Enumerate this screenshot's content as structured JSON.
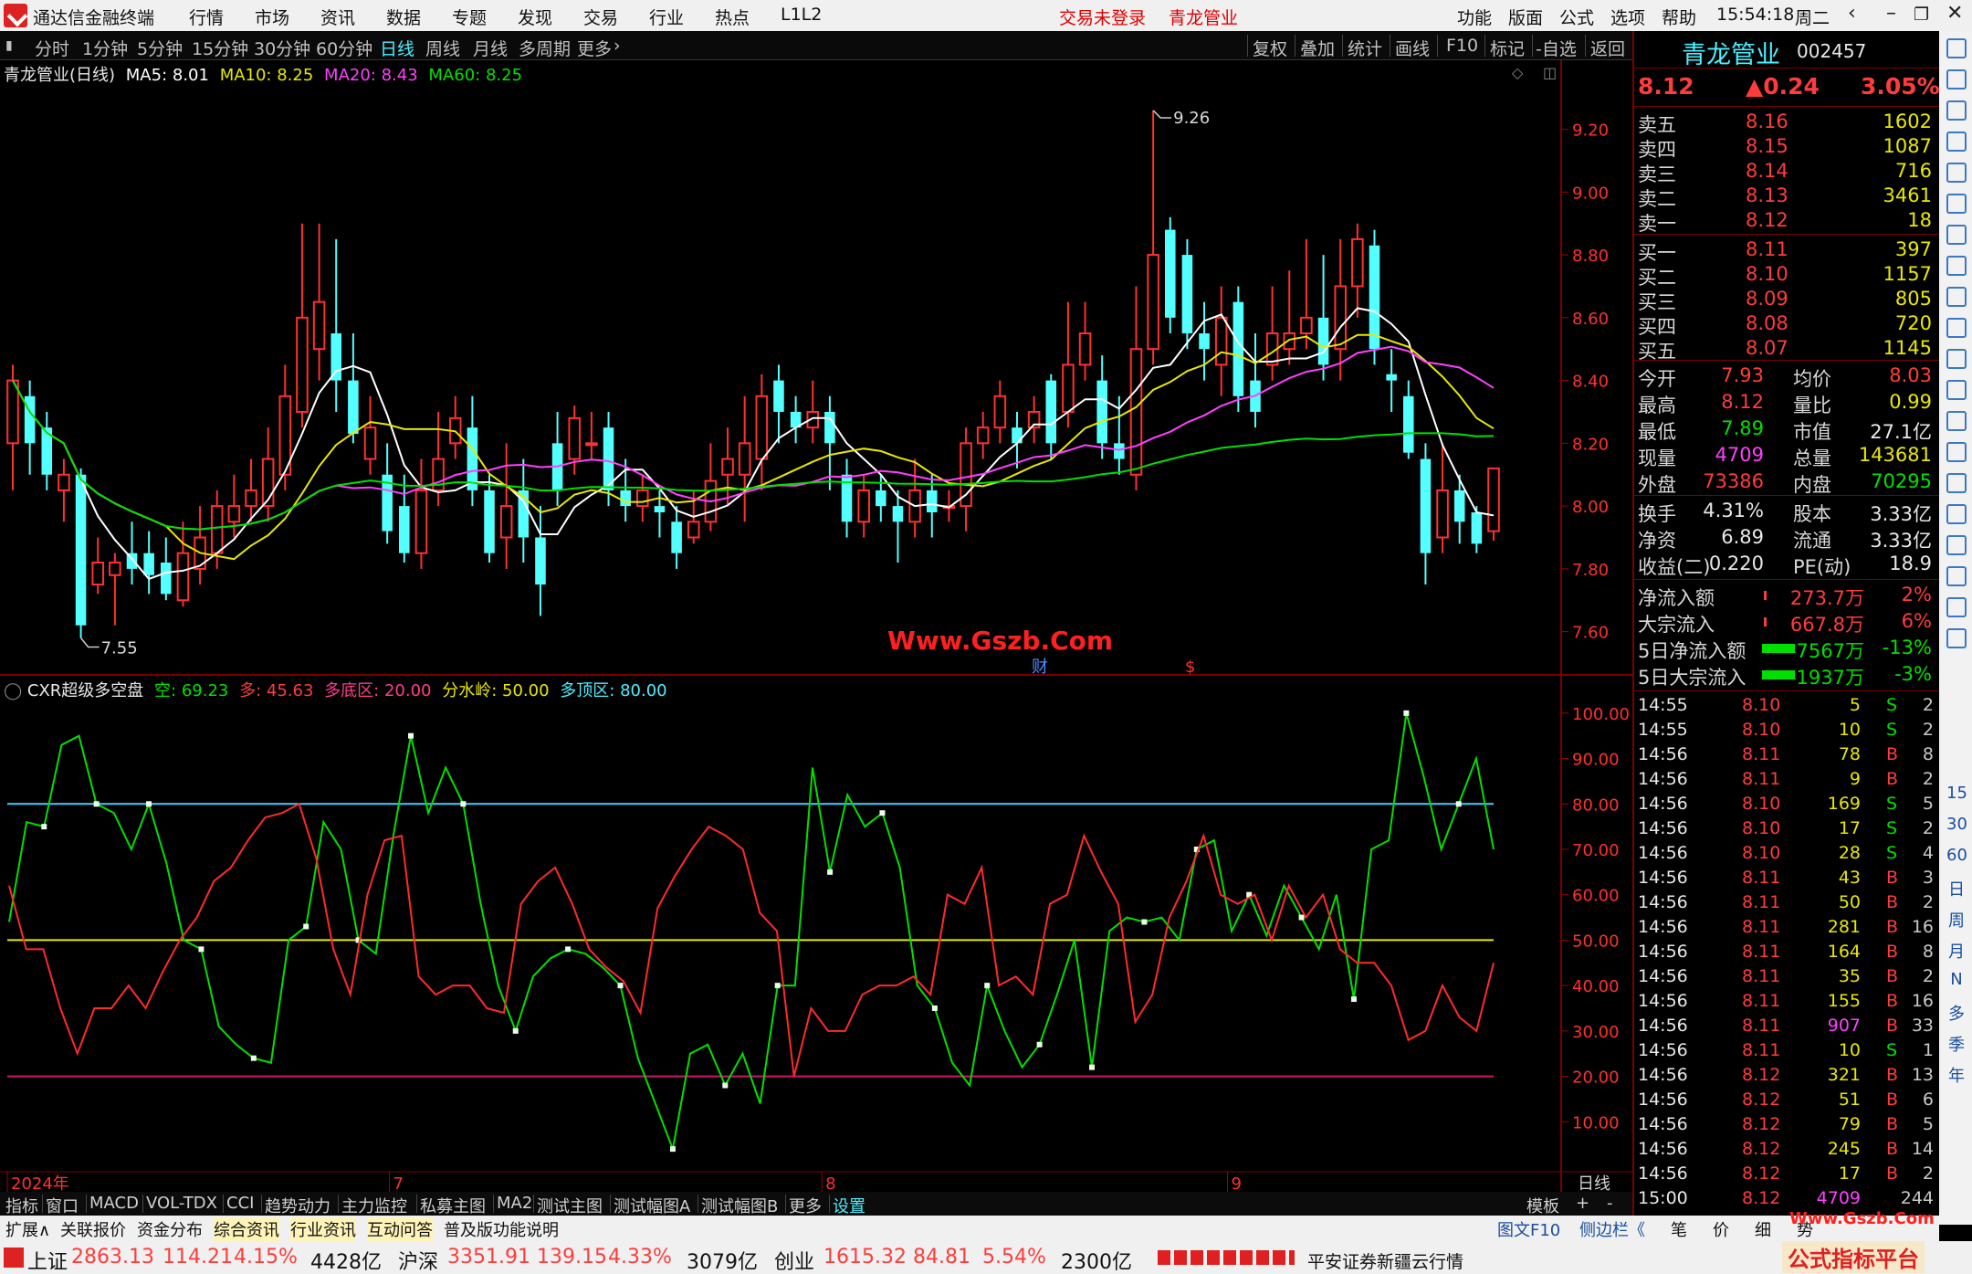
{
  "menubar": {
    "app_title": "通达信金融终端",
    "items": [
      "行情",
      "市场",
      "资讯",
      "数据",
      "专题",
      "发现",
      "交易",
      "行业",
      "热点",
      "L1L2"
    ],
    "trade_status": "交易未登录",
    "stock_name": "青龙管业",
    "right_items": [
      "功能",
      "版面",
      "公式",
      "选项",
      "帮助"
    ],
    "time": "15:54:18",
    "weekday": "周二"
  },
  "toolbar": {
    "periods": [
      "分时",
      "1分钟",
      "5分钟",
      "15分钟",
      "30分钟",
      "60分钟",
      "日线",
      "周线",
      "月线",
      "多周期",
      "更多"
    ],
    "active_period": "日线",
    "right_buttons": [
      "复权",
      "叠加",
      "统计",
      "画线",
      "F10",
      "标记",
      "-自选",
      "返回"
    ]
  },
  "main_chart": {
    "title": "青龙管业(日线)",
    "ma": [
      {
        "label": "MA5: 8.01",
        "color": "#ffffff"
      },
      {
        "label": "MA10: 8.25",
        "color": "#e8e800"
      },
      {
        "label": "MA20: 8.43",
        "color": "#ff40ff"
      },
      {
        "label": "MA60: 8.25",
        "color": "#00e000"
      }
    ],
    "high_label": "9.26",
    "low_label": "7.55",
    "watermark": "Www.Gszb.Com",
    "marker_cai": "财",
    "marker_s": "$"
  },
  "chart_data": [
    {
      "type": "candlestick",
      "title": "青龙管业(日线)",
      "ylim": [
        7.5,
        9.35
      ],
      "yticks": [
        "9.20",
        "9.00",
        "8.80",
        "8.60",
        "8.40",
        "8.20",
        "8.00",
        "7.80",
        "7.60"
      ],
      "xticks": [
        "2024年",
        "7",
        "8",
        "9"
      ],
      "candles": [
        [
          8.2,
          8.4,
          8.45,
          8.05
        ],
        [
          8.35,
          8.2,
          8.4,
          8.1
        ],
        [
          8.25,
          8.1,
          8.3,
          8.05
        ],
        [
          8.05,
          8.1,
          8.15,
          7.95
        ],
        [
          8.1,
          7.62,
          8.12,
          7.58
        ],
        [
          7.75,
          7.82,
          7.9,
          7.72
        ],
        [
          7.78,
          7.82,
          7.85,
          7.62
        ],
        [
          7.85,
          7.8,
          7.95,
          7.75
        ],
        [
          7.85,
          7.78,
          7.92,
          7.72
        ],
        [
          7.82,
          7.72,
          7.9,
          7.7
        ],
        [
          7.7,
          7.85,
          7.95,
          7.68
        ],
        [
          7.8,
          7.9,
          8.0,
          7.75
        ],
        [
          7.85,
          8.0,
          8.05,
          7.8
        ],
        [
          7.95,
          8.0,
          8.1,
          7.9
        ],
        [
          8.0,
          8.05,
          8.15,
          7.95
        ],
        [
          8.0,
          8.15,
          8.25,
          7.95
        ],
        [
          8.1,
          8.35,
          8.45,
          8.05
        ],
        [
          8.3,
          8.6,
          8.9,
          8.25
        ],
        [
          8.5,
          8.65,
          8.9,
          8.4
        ],
        [
          8.55,
          8.4,
          8.85,
          8.3
        ],
        [
          8.4,
          8.23,
          8.55,
          8.2
        ],
        [
          8.15,
          8.25,
          8.35,
          8.1
        ],
        [
          8.1,
          7.92,
          8.2,
          7.88
        ],
        [
          8.0,
          7.85,
          8.1,
          7.82
        ],
        [
          7.85,
          8.05,
          8.15,
          7.8
        ],
        [
          8.05,
          8.15,
          8.3,
          8.0
        ],
        [
          8.2,
          8.28,
          8.35,
          8.15
        ],
        [
          8.25,
          8.05,
          8.35,
          8.0
        ],
        [
          8.05,
          7.85,
          8.1,
          7.82
        ],
        [
          7.9,
          8.0,
          8.2,
          7.8
        ],
        [
          8.05,
          7.9,
          8.15,
          7.82
        ],
        [
          7.9,
          7.75,
          8.0,
          7.65
        ],
        [
          8.2,
          8.05,
          8.3,
          8.0
        ],
        [
          8.15,
          8.28,
          8.32,
          8.1
        ],
        [
          8.2,
          8.2,
          8.3,
          8.15
        ],
        [
          8.25,
          8.05,
          8.3,
          8.0
        ],
        [
          8.05,
          8.0,
          8.15,
          7.95
        ],
        [
          8.0,
          8.05,
          8.1,
          7.95
        ],
        [
          8.0,
          7.98,
          8.05,
          7.9
        ],
        [
          7.95,
          7.85,
          8.0,
          7.8
        ],
        [
          7.9,
          7.95,
          8.05,
          7.88
        ],
        [
          7.95,
          8.08,
          8.2,
          7.92
        ],
        [
          8.1,
          8.15,
          8.25,
          8.0
        ],
        [
          8.1,
          8.2,
          8.35,
          7.95
        ],
        [
          8.15,
          8.35,
          8.42,
          8.05
        ],
        [
          8.4,
          8.3,
          8.45,
          8.2
        ],
        [
          8.3,
          8.25,
          8.35,
          8.2
        ],
        [
          8.25,
          8.3,
          8.4,
          8.2
        ],
        [
          8.3,
          8.2,
          8.35,
          8.05
        ],
        [
          8.1,
          7.95,
          8.15,
          7.9
        ],
        [
          7.95,
          8.05,
          8.1,
          7.9
        ],
        [
          8.05,
          8.0,
          8.1,
          7.95
        ],
        [
          8.0,
          7.95,
          8.05,
          7.82
        ],
        [
          7.95,
          8.05,
          8.15,
          7.9
        ],
        [
          8.05,
          7.98,
          8.1,
          7.9
        ],
        [
          8.0,
          8.0,
          8.05,
          7.95
        ],
        [
          8.0,
          8.2,
          8.25,
          7.92
        ],
        [
          8.2,
          8.25,
          8.3,
          8.15
        ],
        [
          8.25,
          8.35,
          8.4,
          8.2
        ],
        [
          8.25,
          8.2,
          8.3,
          8.12
        ],
        [
          8.25,
          8.3,
          8.35,
          8.2
        ],
        [
          8.4,
          8.2,
          8.42,
          8.15
        ],
        [
          8.3,
          8.45,
          8.65,
          8.25
        ],
        [
          8.45,
          8.55,
          8.65,
          8.4
        ],
        [
          8.4,
          8.2,
          8.48,
          8.15
        ],
        [
          8.2,
          8.15,
          8.35,
          8.1
        ],
        [
          8.1,
          8.5,
          8.7,
          8.05
        ],
        [
          8.5,
          8.8,
          9.26,
          8.45
        ],
        [
          8.88,
          8.6,
          8.92,
          8.55
        ],
        [
          8.8,
          8.55,
          8.85,
          8.5
        ],
        [
          8.55,
          8.5,
          8.65,
          8.4
        ],
        [
          8.45,
          8.6,
          8.7,
          8.35
        ],
        [
          8.65,
          8.35,
          8.7,
          8.3
        ],
        [
          8.4,
          8.3,
          8.55,
          8.25
        ],
        [
          8.45,
          8.55,
          8.7,
          8.4
        ],
        [
          8.5,
          8.55,
          8.75,
          8.45
        ],
        [
          8.55,
          8.6,
          8.85,
          8.5
        ],
        [
          8.6,
          8.45,
          8.8,
          8.4
        ],
        [
          8.5,
          8.7,
          8.85,
          8.4
        ],
        [
          8.7,
          8.85,
          8.9,
          8.6
        ],
        [
          8.83,
          8.5,
          8.88,
          8.45
        ],
        [
          8.42,
          8.4,
          8.5,
          8.3
        ],
        [
          8.35,
          8.17,
          8.4,
          8.15
        ],
        [
          8.15,
          7.85,
          8.2,
          7.75
        ],
        [
          7.9,
          8.05,
          8.2,
          7.85
        ],
        [
          8.05,
          7.95,
          8.1,
          7.88
        ],
        [
          7.98,
          7.88,
          8.0,
          7.85
        ],
        [
          7.92,
          8.12,
          8.12,
          7.89
        ]
      ]
    },
    {
      "type": "line",
      "title": "CXR超级多空盘",
      "ylim": [
        0,
        105
      ],
      "yticks": [
        "100.00",
        "90.00",
        "80.00",
        "70.00",
        "60.00",
        "50.00",
        "40.00",
        "30.00",
        "20.00",
        "10.00"
      ],
      "hlines": [
        {
          "value": 80,
          "color": "#4cc8ff"
        },
        {
          "value": 50,
          "color": "#e8e800"
        },
        {
          "value": 20,
          "color": "#d0186a"
        }
      ],
      "series": [
        {
          "name": "空",
          "color": "#00e000",
          "values": [
            54,
            76,
            75,
            93,
            95,
            80,
            78,
            70,
            80,
            67,
            50,
            48,
            31,
            27,
            24,
            23,
            50,
            53,
            76,
            70,
            50,
            47,
            73,
            95,
            78,
            88,
            80,
            58,
            40,
            30,
            42,
            46,
            48,
            47,
            44,
            40,
            24,
            14,
            4,
            25,
            27,
            18,
            25,
            14,
            40,
            40,
            88,
            65,
            82,
            75,
            78,
            66,
            40,
            35,
            23,
            18,
            40,
            30,
            22,
            27,
            38,
            50,
            22,
            52,
            55,
            54,
            55,
            50,
            70,
            72,
            52,
            60,
            51,
            62,
            55,
            48,
            60,
            37,
            70,
            72,
            100,
            86,
            70,
            80,
            90,
            70
          ]
        },
        {
          "name": "多",
          "color": "#ff2a2a",
          "values": [
            62,
            48,
            48,
            35,
            25,
            35,
            35,
            40,
            35,
            43,
            50,
            55,
            63,
            66,
            72,
            77,
            78,
            80,
            68,
            48,
            38,
            60,
            72,
            73,
            42,
            38,
            40,
            40,
            35,
            34,
            58,
            63,
            66,
            58,
            48,
            44,
            41,
            34,
            57,
            64,
            70,
            75,
            73,
            70,
            56,
            52,
            20,
            35,
            30,
            30,
            38,
            40,
            40,
            42,
            38,
            60,
            58,
            66,
            40,
            42,
            38,
            58,
            60,
            73,
            65,
            58,
            32,
            38,
            55,
            63,
            73,
            60,
            58,
            60,
            50,
            62,
            55,
            60,
            48,
            45,
            45,
            40,
            28,
            30,
            40,
            33,
            30,
            45
          ]
        }
      ],
      "values_text": {
        "kong": "空: 69.23",
        "duo": "多: 45.63",
        "dudi": "多底区: 20.00",
        "fenshuiling": "分水岭: 50.00",
        "duoding": "多顶区: 80.00"
      }
    }
  ],
  "quote": {
    "name": "青龙管业",
    "code": "002457",
    "price": "8.12",
    "change": "▲0.24",
    "pct": "3.05%",
    "asks": [
      {
        "label": "卖五",
        "price": "8.16",
        "vol": "1602"
      },
      {
        "label": "卖四",
        "price": "8.15",
        "vol": "1087"
      },
      {
        "label": "卖三",
        "price": "8.14",
        "vol": "716"
      },
      {
        "label": "卖二",
        "price": "8.13",
        "vol": "3461"
      },
      {
        "label": "卖一",
        "price": "8.12",
        "vol": "18"
      }
    ],
    "bids": [
      {
        "label": "买一",
        "price": "8.11",
        "vol": "397"
      },
      {
        "label": "买二",
        "price": "8.10",
        "vol": "1157"
      },
      {
        "label": "买三",
        "price": "8.09",
        "vol": "805"
      },
      {
        "label": "买四",
        "price": "8.08",
        "vol": "720"
      },
      {
        "label": "买五",
        "price": "8.07",
        "vol": "1145"
      }
    ],
    "stats1": [
      [
        "今开",
        "7.93",
        "均价",
        "8.03"
      ],
      [
        "最高",
        "8.12",
        "量比",
        "0.99"
      ],
      [
        "最低",
        "7.89",
        "市值",
        "27.1亿"
      ],
      [
        "现量",
        "4709",
        "总量",
        "143681"
      ],
      [
        "外盘",
        "73386",
        "内盘",
        "70295"
      ]
    ],
    "stats2": [
      [
        "换手",
        "4.31%",
        "股本",
        "3.33亿"
      ],
      [
        "净资",
        "6.89",
        "流通",
        "3.33亿"
      ],
      [
        "收益(二)",
        "0.220",
        "PE(动)",
        "18.9"
      ]
    ],
    "flows": [
      {
        "label": "净流入额",
        "value": "273.7万",
        "pct": "2%",
        "dir": "up"
      },
      {
        "label": "大宗流入",
        "value": "667.8万",
        "pct": "6%",
        "dir": "up"
      },
      {
        "label": "5日净流入额",
        "value": "-7567万",
        "pct": "-13%",
        "dir": "down"
      },
      {
        "label": "5日大宗流入",
        "value": "-1937万",
        "pct": "-3%",
        "dir": "down"
      }
    ],
    "ticks": [
      [
        "14:55",
        "8.10",
        "5",
        "S",
        "2"
      ],
      [
        "14:55",
        "8.10",
        "10",
        "S",
        "2"
      ],
      [
        "14:56",
        "8.11",
        "78",
        "B",
        "8"
      ],
      [
        "14:56",
        "8.11",
        "9",
        "B",
        "2"
      ],
      [
        "14:56",
        "8.10",
        "169",
        "S",
        "5"
      ],
      [
        "14:56",
        "8.10",
        "17",
        "S",
        "2"
      ],
      [
        "14:56",
        "8.10",
        "28",
        "S",
        "4"
      ],
      [
        "14:56",
        "8.11",
        "43",
        "B",
        "3"
      ],
      [
        "14:56",
        "8.11",
        "50",
        "B",
        "2"
      ],
      [
        "14:56",
        "8.11",
        "281",
        "B",
        "16"
      ],
      [
        "14:56",
        "8.11",
        "164",
        "B",
        "8"
      ],
      [
        "14:56",
        "8.11",
        "35",
        "B",
        "2"
      ],
      [
        "14:56",
        "8.11",
        "155",
        "B",
        "16"
      ],
      [
        "14:56",
        "8.11",
        "907",
        "B",
        "33"
      ],
      [
        "14:56",
        "8.11",
        "10",
        "S",
        "1"
      ],
      [
        "14:56",
        "8.12",
        "321",
        "B",
        "13"
      ],
      [
        "14:56",
        "8.12",
        "51",
        "B",
        "6"
      ],
      [
        "14:56",
        "8.12",
        "79",
        "B",
        "5"
      ],
      [
        "14:56",
        "8.12",
        "245",
        "B",
        "14"
      ],
      [
        "14:56",
        "8.12",
        "17",
        "B",
        "2"
      ],
      [
        "15:00",
        "8.12",
        "4709",
        "",
        "244"
      ]
    ]
  },
  "strip": {
    "labels": [
      "15",
      "30",
      "60",
      "日",
      "周",
      "月",
      "N",
      "多",
      "季",
      "年"
    ]
  },
  "tabs1": {
    "items": [
      "指标",
      "窗口",
      "MACD",
      "VOL-TDX",
      "CCI",
      "趋势动力",
      "主力监控",
      "私募主图",
      "MA2",
      "测试主图",
      "测试幅图A",
      "测试幅图B",
      "更多",
      "设置"
    ],
    "active": "设置",
    "right": [
      "模板",
      "+",
      "-"
    ],
    "period_label": "日线"
  },
  "tabs2": {
    "items": [
      "扩展∧",
      "关联报价",
      "资金分布",
      "综合资讯",
      "行业资讯",
      "互动问答",
      "普及版功能说明"
    ],
    "right": [
      "图文F10",
      "侧边栏《",
      "笔",
      "价",
      "细",
      "势"
    ]
  },
  "statusbar": {
    "indices": [
      {
        "name": "上证",
        "value": "2863.13",
        "chg": "114.21",
        "pct": "4.15%",
        "amt": "4428亿"
      },
      {
        "name": "沪深",
        "value": "3351.91",
        "chg": "139.15",
        "pct": "4.33%",
        "amt": "3079亿"
      },
      {
        "name": "创业",
        "value": "1615.32",
        "chg": "84.81",
        "pct": "5.54%",
        "amt": "2300亿"
      }
    ],
    "server": "平安证券新疆云行情",
    "brand": "公式指标平台",
    "brand_url": "Www.Gszb.Com"
  }
}
